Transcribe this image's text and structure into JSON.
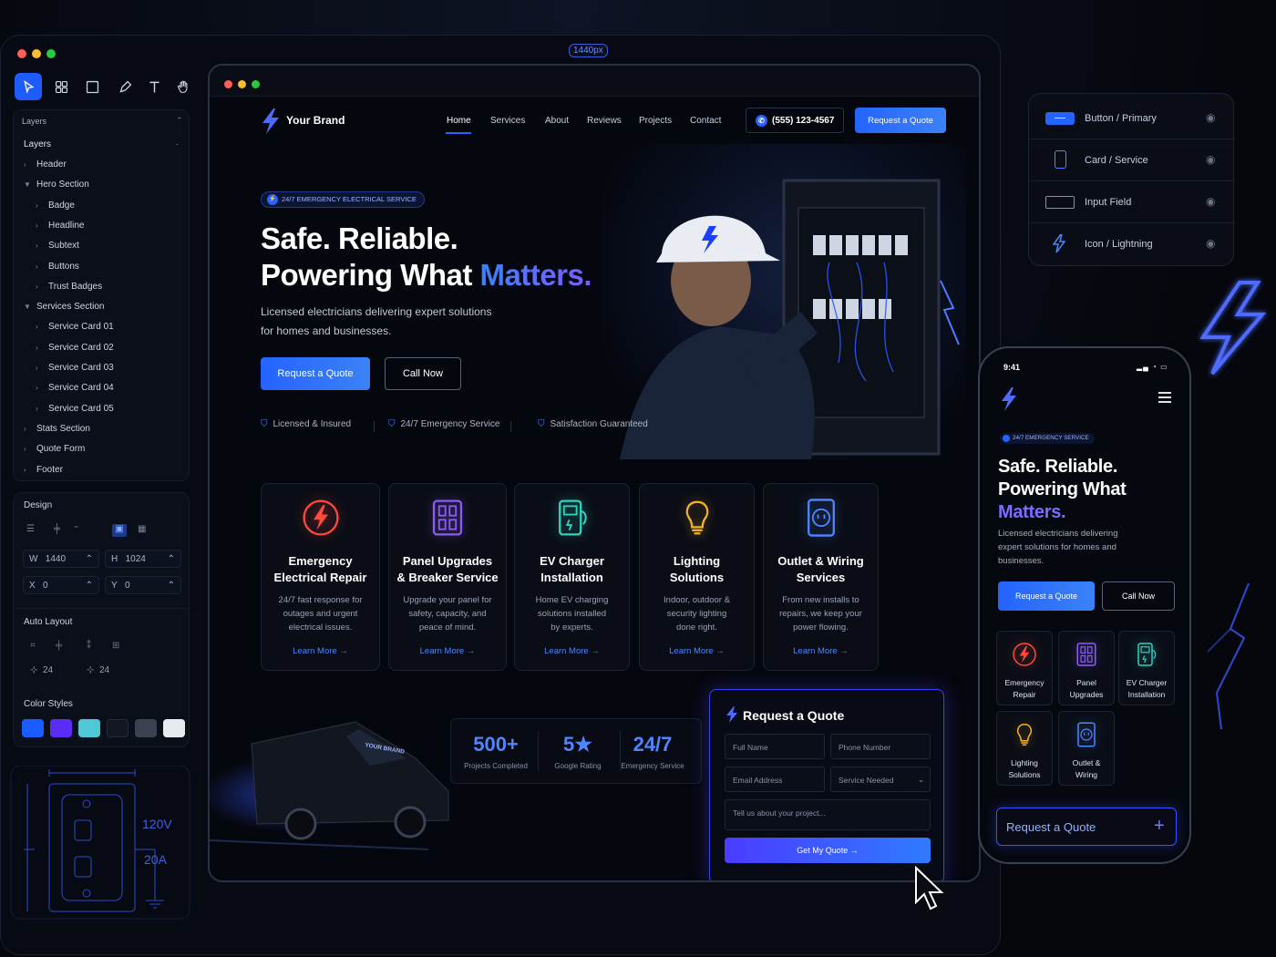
{
  "editor": {
    "window_controls": [
      "close",
      "minimize",
      "maximize"
    ],
    "width_chip": "1440px",
    "toolbar_tools": [
      "cursor-icon",
      "frame-icon",
      "rectangle-icon",
      "pen-icon",
      "text-icon",
      "hand-icon"
    ],
    "layers_panel_title": "Layers",
    "layers_heading": "Layers",
    "layers": [
      {
        "label": "Header",
        "depth": 0,
        "expanded": false
      },
      {
        "label": "Hero Section",
        "depth": 0,
        "expanded": true
      },
      {
        "label": "Badge",
        "depth": 1,
        "expanded": false
      },
      {
        "label": "Headline",
        "depth": 1,
        "expanded": false
      },
      {
        "label": "Subtext",
        "depth": 1,
        "expanded": false
      },
      {
        "label": "Buttons",
        "depth": 1,
        "expanded": false
      },
      {
        "label": "Trust Badges",
        "depth": 1,
        "expanded": false
      },
      {
        "label": "Services Section",
        "depth": 0,
        "expanded": true
      },
      {
        "label": "Service Card 01",
        "depth": 1,
        "expanded": false
      },
      {
        "label": "Service Card 02",
        "depth": 1,
        "expanded": false
      },
      {
        "label": "Service Card 03",
        "depth": 1,
        "expanded": false
      },
      {
        "label": "Service Card 04",
        "depth": 1,
        "expanded": false
      },
      {
        "label": "Service Card 05",
        "depth": 1,
        "expanded": false
      },
      {
        "label": "Stats Section",
        "depth": 0,
        "expanded": false
      },
      {
        "label": "Quote Form",
        "depth": 0,
        "expanded": false
      },
      {
        "label": "Footer",
        "depth": 0,
        "expanded": false
      }
    ],
    "design": {
      "title": "Design",
      "w_label": "W",
      "w_value": "1440",
      "h_label": "H",
      "h_value": "1024",
      "x_label": "X",
      "x_value": "0",
      "y_label": "Y",
      "y_value": "0",
      "auto_layout_title": "Auto Layout",
      "gap_h": "24",
      "gap_v": "24",
      "color_styles_title": "Color Styles",
      "color_styles": [
        "#1a5cff",
        "#5b2cf5",
        "#4fc8d6",
        "#121722",
        "#3a4150",
        "#e8eaef"
      ]
    },
    "blueprint": {
      "voltage": "120V",
      "amperage": "20A"
    }
  },
  "site": {
    "brand": "Your Brand",
    "nav": [
      "Home",
      "Services",
      "About",
      "Reviews",
      "Projects",
      "Contact"
    ],
    "active_nav": "Home",
    "phone": "(555) 123-4567",
    "header_cta": "Request a Quote",
    "hero": {
      "badge": "24/7 EMERGENCY ELECTRICAL SERVICE",
      "headline_line1": "Safe. Reliable.",
      "headline_line2_prefix": "Powering What ",
      "headline_highlight": "Matters.",
      "subtext_line1": "Licensed electricians delivering expert solutions",
      "subtext_line2": "for homes and businesses.",
      "primary_cta": "Request a Quote",
      "secondary_cta": "Call Now",
      "trust": [
        "Licensed & Insured",
        "24/7 Emergency Service",
        "Satisfaction Guaranteed"
      ]
    },
    "services": [
      {
        "icon": "bolt-icon",
        "title_line1": "Emergency",
        "title_line2": "Electrical Repair",
        "desc": [
          "24/7 fast response for",
          "outages and urgent",
          "electrical issues."
        ],
        "link": "Learn More →",
        "color": "#ff4a3d"
      },
      {
        "icon": "breaker-panel-icon",
        "title_line1": "Panel Upgrades",
        "title_line2": "& Breaker Service",
        "desc": [
          "Upgrade your panel for",
          "safety, capacity, and",
          "peace of mind."
        ],
        "link": "Learn More →",
        "color": "#8b5cf6"
      },
      {
        "icon": "ev-charger-icon",
        "title_line1": "EV Charger",
        "title_line2": "Installation",
        "desc": [
          "Home EV charging",
          "solutions installed",
          "by experts."
        ],
        "link": "Learn More →",
        "color": "#2dd4bf"
      },
      {
        "icon": "lightbulb-icon",
        "title_line1": "Lighting",
        "title_line2": "Solutions",
        "desc": [
          "Indoor, outdoor &",
          "security lighting",
          "done right."
        ],
        "link": "Learn More →",
        "color": "#f5b324"
      },
      {
        "icon": "outlet-icon",
        "title_line1": "Outlet & Wiring",
        "title_line2": "Services",
        "desc": [
          "From new installs to",
          "repairs, we keep your",
          "power flowing."
        ],
        "link": "Learn More →",
        "color": "#4f86ff"
      }
    ],
    "van_decal": "YOUR BRAND",
    "stats": [
      {
        "value": "500+",
        "label": "Projects Completed"
      },
      {
        "value": "5★",
        "label": "Google Rating"
      },
      {
        "value": "24/7",
        "label": "Emergency Service"
      }
    ],
    "quote_form": {
      "title": "Request a Quote",
      "full_name_placeholder": "Full Name",
      "phone_placeholder": "Phone Number",
      "email_placeholder": "Email Address",
      "service_placeholder": "Service Needed",
      "message_placeholder": "Tell us about your project...",
      "submit": "Get My Quote →"
    }
  },
  "components": [
    {
      "label": "Button / Primary",
      "icon": "button-preview-icon"
    },
    {
      "label": "Card / Service",
      "icon": "card-preview-icon"
    },
    {
      "label": "Input Field",
      "icon": "input-preview-icon"
    },
    {
      "label": "Icon / Lightning",
      "icon": "lightning-icon"
    }
  ],
  "phone": {
    "time": "9:41",
    "badge": "24/7 EMERGENCY SERVICE",
    "headline_line1": "Safe. Reliable.",
    "headline_line2": "Powering What",
    "headline_highlight": "Matters.",
    "subtext": [
      "Licensed electricians delivering",
      "expert solutions for homes and",
      "businesses."
    ],
    "primary_cta": "Request a Quote",
    "secondary_cta": "Call Now",
    "services": [
      {
        "line1": "Emergency",
        "line2": "Repair",
        "color": "#ff4a3d"
      },
      {
        "line1": "Panel",
        "line2": "Upgrades",
        "color": "#8b5cf6"
      },
      {
        "line1": "EV Charger",
        "line2": "Installation",
        "color": "#2dd4bf"
      },
      {
        "line1": "Lighting",
        "line2": "Solutions",
        "color": "#f5b324"
      },
      {
        "line1": "Outlet &",
        "line2": "Wiring",
        "color": "#4f86ff"
      }
    ],
    "bottom_cta": "Request a Quote",
    "bottom_cta_icon": "+"
  },
  "colors": {
    "accent": "#2563ff",
    "highlight": "#6d5cff",
    "link": "#4f86ff"
  }
}
